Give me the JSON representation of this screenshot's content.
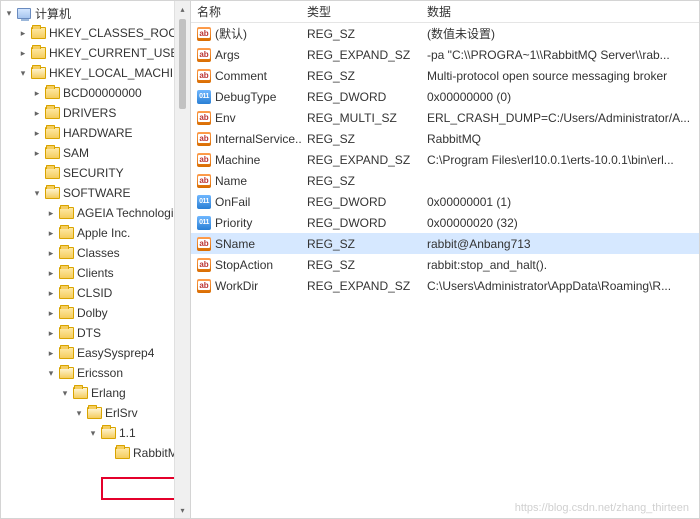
{
  "tree": {
    "root_label": "计算机",
    "items": [
      {
        "label": "HKEY_CLASSES_ROOT",
        "depth": 1,
        "twisty": "closed",
        "icon": "folder-closed"
      },
      {
        "label": "HKEY_CURRENT_USER",
        "depth": 1,
        "twisty": "closed",
        "icon": "folder-closed"
      },
      {
        "label": "HKEY_LOCAL_MACHINE",
        "depth": 1,
        "twisty": "open",
        "icon": "folder-open"
      },
      {
        "label": "BCD00000000",
        "depth": 2,
        "twisty": "closed",
        "icon": "folder-closed"
      },
      {
        "label": "DRIVERS",
        "depth": 2,
        "twisty": "closed",
        "icon": "folder-closed"
      },
      {
        "label": "HARDWARE",
        "depth": 2,
        "twisty": "closed",
        "icon": "folder-closed"
      },
      {
        "label": "SAM",
        "depth": 2,
        "twisty": "closed",
        "icon": "folder-closed"
      },
      {
        "label": "SECURITY",
        "depth": 2,
        "twisty": "blank",
        "icon": "folder-closed"
      },
      {
        "label": "SOFTWARE",
        "depth": 2,
        "twisty": "open",
        "icon": "folder-open"
      },
      {
        "label": "AGEIA Technologies",
        "depth": 3,
        "twisty": "closed",
        "icon": "folder-closed"
      },
      {
        "label": "Apple Inc.",
        "depth": 3,
        "twisty": "closed",
        "icon": "folder-closed"
      },
      {
        "label": "Classes",
        "depth": 3,
        "twisty": "closed",
        "icon": "folder-closed"
      },
      {
        "label": "Clients",
        "depth": 3,
        "twisty": "closed",
        "icon": "folder-closed"
      },
      {
        "label": "CLSID",
        "depth": 3,
        "twisty": "closed",
        "icon": "folder-closed"
      },
      {
        "label": "Dolby",
        "depth": 3,
        "twisty": "closed",
        "icon": "folder-closed"
      },
      {
        "label": "DTS",
        "depth": 3,
        "twisty": "closed",
        "icon": "folder-closed"
      },
      {
        "label": "EasySysprep4",
        "depth": 3,
        "twisty": "closed",
        "icon": "folder-closed"
      },
      {
        "label": "Ericsson",
        "depth": 3,
        "twisty": "open",
        "icon": "folder-open"
      },
      {
        "label": "Erlang",
        "depth": 4,
        "twisty": "open",
        "icon": "folder-open"
      },
      {
        "label": "ErlSrv",
        "depth": 5,
        "twisty": "open",
        "icon": "folder-open"
      },
      {
        "label": "1.1",
        "depth": 6,
        "twisty": "open",
        "icon": "folder-open"
      },
      {
        "label": "RabbitM",
        "depth": 7,
        "twisty": "blank",
        "icon": "folder-closed",
        "highlighted": true
      }
    ]
  },
  "columns": {
    "name": "名称",
    "type": "类型",
    "data": "数据"
  },
  "rows": [
    {
      "icon": "sz",
      "name": "(默认)",
      "type": "REG_SZ",
      "data": "(数值未设置)"
    },
    {
      "icon": "sz",
      "name": "Args",
      "type": "REG_EXPAND_SZ",
      "data": " -pa \"C:\\\\PROGRA~1\\\\RabbitMQ Server\\\\rab..."
    },
    {
      "icon": "sz",
      "name": "Comment",
      "type": "REG_SZ",
      "data": "Multi-protocol open source messaging broker"
    },
    {
      "icon": "dw",
      "name": "DebugType",
      "type": "REG_DWORD",
      "data": "0x00000000 (0)"
    },
    {
      "icon": "sz",
      "name": "Env",
      "type": "REG_MULTI_SZ",
      "data": "ERL_CRASH_DUMP=C:/Users/Administrator/A..."
    },
    {
      "icon": "sz",
      "name": "InternalService...",
      "type": "REG_SZ",
      "data": "RabbitMQ"
    },
    {
      "icon": "sz",
      "name": "Machine",
      "type": "REG_EXPAND_SZ",
      "data": "C:\\Program Files\\erl10.0.1\\erts-10.0.1\\bin\\erl..."
    },
    {
      "icon": "sz",
      "name": "Name",
      "type": "REG_SZ",
      "data": ""
    },
    {
      "icon": "dw",
      "name": "OnFail",
      "type": "REG_DWORD",
      "data": "0x00000001 (1)"
    },
    {
      "icon": "dw",
      "name": "Priority",
      "type": "REG_DWORD",
      "data": "0x00000020 (32)"
    },
    {
      "icon": "sz",
      "name": "SName",
      "type": "REG_SZ",
      "data": "rabbit@Anbang713",
      "selected": true
    },
    {
      "icon": "sz",
      "name": "StopAction",
      "type": "REG_SZ",
      "data": "rabbit:stop_and_halt()."
    },
    {
      "icon": "sz",
      "name": "WorkDir",
      "type": "REG_EXPAND_SZ",
      "data": "C:\\Users\\Administrator\\AppData\\Roaming\\R..."
    }
  ],
  "watermark": "https://blog.csdn.net/zhang_thirteen"
}
